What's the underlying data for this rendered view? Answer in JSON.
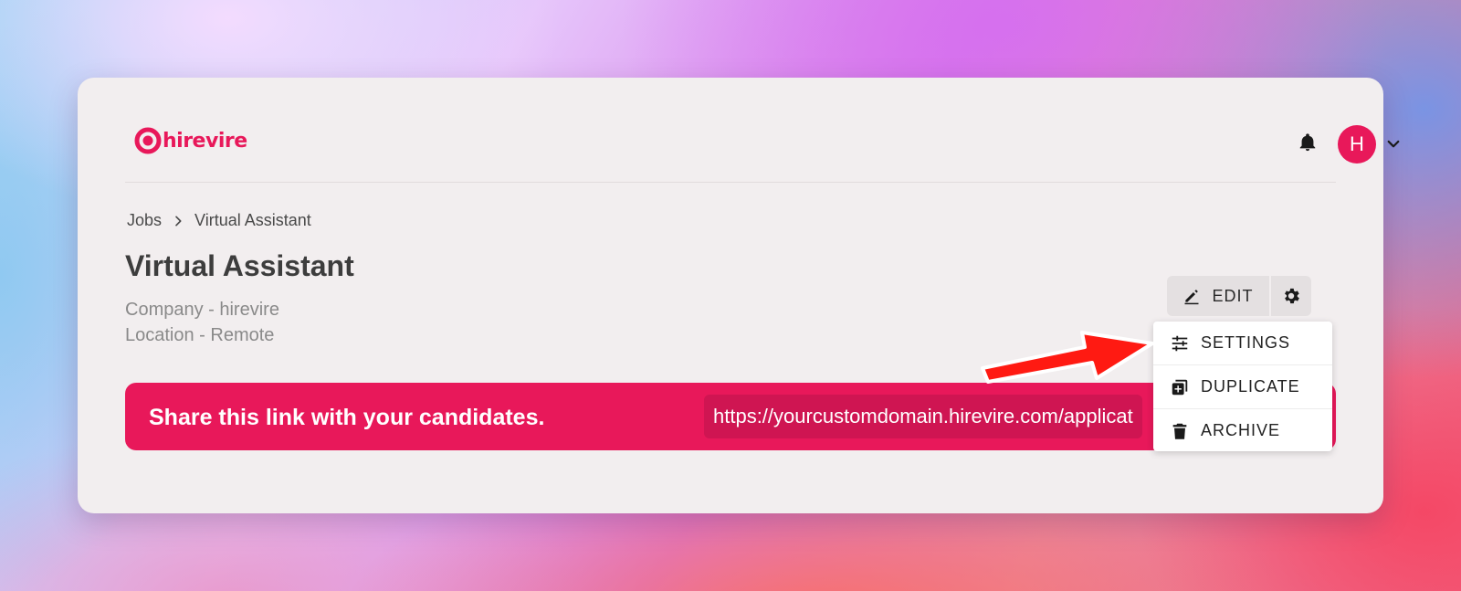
{
  "brand": {
    "name": "hirevire",
    "color": "#e8185a"
  },
  "header": {
    "avatar_initial": "H",
    "notification_icon": "bell-icon",
    "menu_icon": "chevron-down-icon"
  },
  "breadcrumb": {
    "parent": "Jobs",
    "current": "Virtual Assistant"
  },
  "job": {
    "title": "Virtual Assistant",
    "company": "Company - hirevire",
    "location": "Location - Remote"
  },
  "share": {
    "label": "Share this link with your candidates.",
    "url": "https://yourcustomdomain.hirevire.com/applicat"
  },
  "actions": {
    "edit_label": "EDIT",
    "settings_icon": "gear-icon"
  },
  "menu": {
    "items": [
      {
        "label": "SETTINGS",
        "icon": "sliders-icon"
      },
      {
        "label": "DUPLICATE",
        "icon": "duplicate-icon"
      },
      {
        "label": "ARCHIVE",
        "icon": "trash-icon"
      }
    ]
  },
  "annotation": {
    "arrow_color": "#ff1010"
  }
}
